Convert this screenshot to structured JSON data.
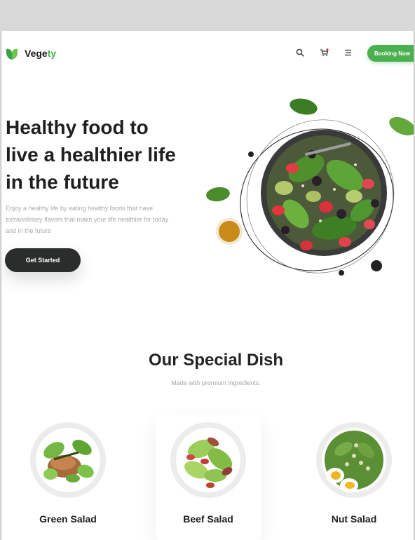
{
  "brand": {
    "name_main": "Vege",
    "name_accent": "ty",
    "accent_color": "#40b14a"
  },
  "header": {
    "icons": [
      "search-icon",
      "cart-icon",
      "menu-icon"
    ],
    "booking_label": "Booking Now",
    "booking_color": "#4caf50"
  },
  "hero": {
    "title_line1": "Healthy food to",
    "title_line2": "live a healthier life",
    "title_line3": "in the future",
    "description": "Enjoy a healthy life by eating healthy foods that have extraordinary flavors that make your life healthier for today and in the future",
    "cta_label": "Get Started"
  },
  "special": {
    "title": "Our Special Dish",
    "subtitle": "Made with premium ingredients.",
    "dishes": [
      {
        "name": "Green Salad"
      },
      {
        "name": "Beef Salad"
      },
      {
        "name": "Nut Salad"
      }
    ]
  }
}
